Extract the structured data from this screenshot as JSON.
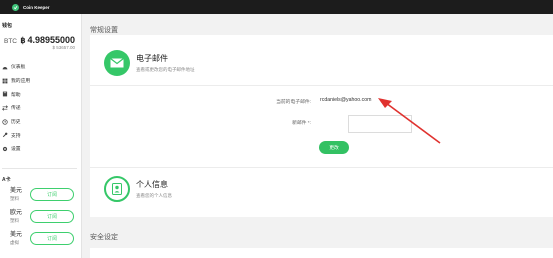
{
  "app": {
    "title": "Coin Keeper"
  },
  "sidebar": {
    "wallet_title": "钱包",
    "btc_label": "BTC",
    "btc_symbol": "฿",
    "btc_amount": "4.98955000",
    "btc_sub": "$ 53657.00",
    "nav": [
      {
        "label": "仪表板",
        "icon": "dashboard-icon"
      },
      {
        "label": "我的应用",
        "icon": "apps-icon"
      },
      {
        "label": "帮助",
        "icon": "book-icon"
      },
      {
        "label": "传递",
        "icon": "transfer-icon"
      },
      {
        "label": "历史",
        "icon": "history-icon"
      },
      {
        "label": "支持",
        "icon": "wrench-icon"
      },
      {
        "label": "设置",
        "icon": "gear-icon"
      }
    ],
    "notifications_title": "A卡",
    "notifications": [
      {
        "currency": "美元",
        "type": "塑料",
        "button": "订阅"
      },
      {
        "currency": "欧元",
        "type": "塑料",
        "button": "订阅"
      },
      {
        "currency": "美元",
        "type": "虚拟",
        "button": "订阅"
      }
    ]
  },
  "main": {
    "section_general": "常规设置",
    "section_security": "安全设定",
    "email": {
      "title": "电子邮件",
      "subtitle": "查看或更改您的电子邮件地址",
      "current_label": "当前的电子邮件:",
      "current_value": "rcdaniels@yahoo.com",
      "new_label": "新邮件 *:",
      "new_value": "",
      "change_button": "更改"
    },
    "personal": {
      "title": "个人信息",
      "subtitle": "查看您的个人信息"
    }
  },
  "colors": {
    "accent": "#35c768",
    "annotation": "#e0322f",
    "topbar": "#1c1c1c"
  }
}
